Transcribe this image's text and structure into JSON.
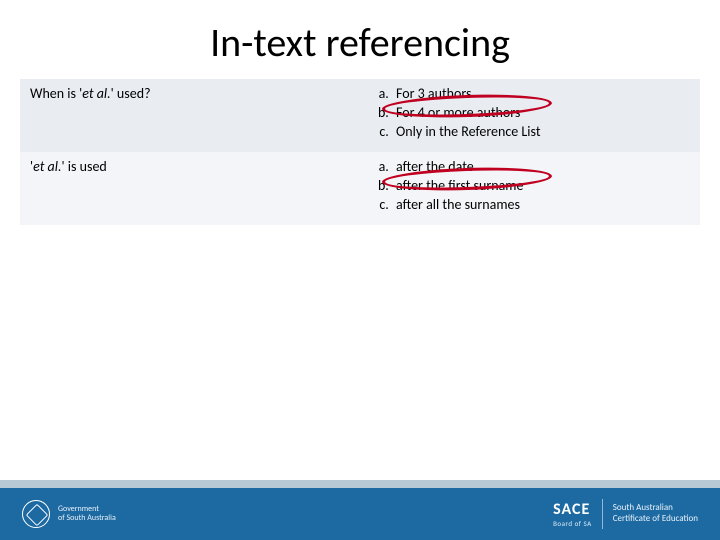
{
  "title": "In-text referencing",
  "rows": [
    {
      "question_pre": "When is '",
      "question_em": "et al.",
      "question_post": "' used?",
      "options": [
        "For 3 authors",
        "For 4 or more authors",
        "Only in the Reference List"
      ],
      "circled_index": 1
    },
    {
      "question_pre": "'",
      "question_em": "et al.",
      "question_post": "' is used",
      "options": [
        "after the date",
        "after the first surname",
        "after all the surnames"
      ],
      "circled_index": 1
    }
  ],
  "footer": {
    "gov_line1": "Government",
    "gov_line2": "of South Australia",
    "sace_brand": "SACE",
    "sace_sub": "Board of SA",
    "sace_desc1": "South Australian",
    "sace_desc2": "Certificate of Education"
  }
}
